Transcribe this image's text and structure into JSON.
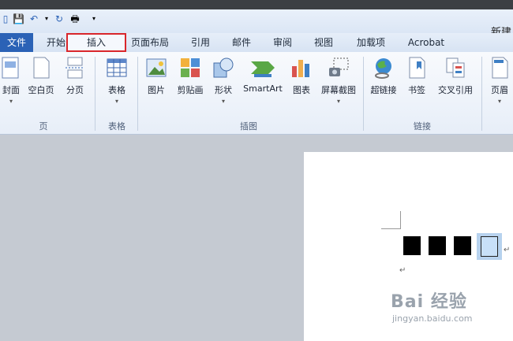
{
  "window": {
    "title": "新建"
  },
  "tabs": [
    {
      "label": "文件"
    },
    {
      "label": "开始"
    },
    {
      "label": "插入"
    },
    {
      "label": "页面布局"
    },
    {
      "label": "引用"
    },
    {
      "label": "邮件"
    },
    {
      "label": "审阅"
    },
    {
      "label": "视图"
    },
    {
      "label": "加载项"
    },
    {
      "label": "Acrobat"
    }
  ],
  "ribbon": {
    "groups": {
      "pages": {
        "label": "页",
        "buttons": [
          {
            "label": "封面"
          },
          {
            "label": "空白页"
          },
          {
            "label": "分页"
          }
        ]
      },
      "tables": {
        "label": "表格",
        "buttons": [
          {
            "label": "表格"
          }
        ]
      },
      "illustrations": {
        "label": "插图",
        "buttons": [
          {
            "label": "图片"
          },
          {
            "label": "剪贴画"
          },
          {
            "label": "形状"
          },
          {
            "label": "SmartArt"
          },
          {
            "label": "图表"
          },
          {
            "label": "屏幕截图"
          }
        ]
      },
      "links": {
        "label": "链接",
        "buttons": [
          {
            "label": "超链接"
          },
          {
            "label": "书签"
          },
          {
            "label": "交叉引用"
          }
        ]
      },
      "headerfooter": {
        "buttons": [
          {
            "label": "页眉"
          }
        ]
      }
    }
  },
  "document": {
    "para_mark": "↵"
  },
  "watermark": {
    "brand": "Bai 经验",
    "url": "jingyan.baidu.com"
  },
  "colors": {
    "file_tab": "#2b62b6",
    "highlight": "#d9262b",
    "selection": "#b7d2ee"
  }
}
